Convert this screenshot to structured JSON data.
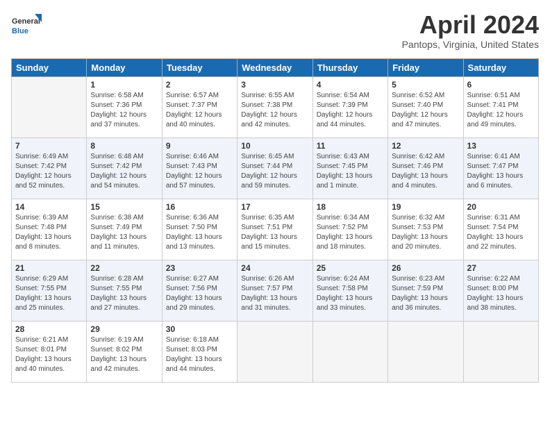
{
  "header": {
    "logo_general": "General",
    "logo_blue": "Blue",
    "main_title": "April 2024",
    "sub_title": "Pantops, Virginia, United States"
  },
  "weekdays": [
    "Sunday",
    "Monday",
    "Tuesday",
    "Wednesday",
    "Thursday",
    "Friday",
    "Saturday"
  ],
  "weeks": [
    [
      {
        "day": "",
        "sunrise": "",
        "sunset": "",
        "daylight": "",
        "empty": true
      },
      {
        "day": "1",
        "sunrise": "Sunrise: 6:58 AM",
        "sunset": "Sunset: 7:36 PM",
        "daylight": "Daylight: 12 hours and 37 minutes."
      },
      {
        "day": "2",
        "sunrise": "Sunrise: 6:57 AM",
        "sunset": "Sunset: 7:37 PM",
        "daylight": "Daylight: 12 hours and 40 minutes."
      },
      {
        "day": "3",
        "sunrise": "Sunrise: 6:55 AM",
        "sunset": "Sunset: 7:38 PM",
        "daylight": "Daylight: 12 hours and 42 minutes."
      },
      {
        "day": "4",
        "sunrise": "Sunrise: 6:54 AM",
        "sunset": "Sunset: 7:39 PM",
        "daylight": "Daylight: 12 hours and 44 minutes."
      },
      {
        "day": "5",
        "sunrise": "Sunrise: 6:52 AM",
        "sunset": "Sunset: 7:40 PM",
        "daylight": "Daylight: 12 hours and 47 minutes."
      },
      {
        "day": "6",
        "sunrise": "Sunrise: 6:51 AM",
        "sunset": "Sunset: 7:41 PM",
        "daylight": "Daylight: 12 hours and 49 minutes."
      }
    ],
    [
      {
        "day": "7",
        "sunrise": "Sunrise: 6:49 AM",
        "sunset": "Sunset: 7:42 PM",
        "daylight": "Daylight: 12 hours and 52 minutes."
      },
      {
        "day": "8",
        "sunrise": "Sunrise: 6:48 AM",
        "sunset": "Sunset: 7:42 PM",
        "daylight": "Daylight: 12 hours and 54 minutes."
      },
      {
        "day": "9",
        "sunrise": "Sunrise: 6:46 AM",
        "sunset": "Sunset: 7:43 PM",
        "daylight": "Daylight: 12 hours and 57 minutes."
      },
      {
        "day": "10",
        "sunrise": "Sunrise: 6:45 AM",
        "sunset": "Sunset: 7:44 PM",
        "daylight": "Daylight: 12 hours and 59 minutes."
      },
      {
        "day": "11",
        "sunrise": "Sunrise: 6:43 AM",
        "sunset": "Sunset: 7:45 PM",
        "daylight": "Daylight: 13 hours and 1 minute."
      },
      {
        "day": "12",
        "sunrise": "Sunrise: 6:42 AM",
        "sunset": "Sunset: 7:46 PM",
        "daylight": "Daylight: 13 hours and 4 minutes."
      },
      {
        "day": "13",
        "sunrise": "Sunrise: 6:41 AM",
        "sunset": "Sunset: 7:47 PM",
        "daylight": "Daylight: 13 hours and 6 minutes."
      }
    ],
    [
      {
        "day": "14",
        "sunrise": "Sunrise: 6:39 AM",
        "sunset": "Sunset: 7:48 PM",
        "daylight": "Daylight: 13 hours and 8 minutes."
      },
      {
        "day": "15",
        "sunrise": "Sunrise: 6:38 AM",
        "sunset": "Sunset: 7:49 PM",
        "daylight": "Daylight: 13 hours and 11 minutes."
      },
      {
        "day": "16",
        "sunrise": "Sunrise: 6:36 AM",
        "sunset": "Sunset: 7:50 PM",
        "daylight": "Daylight: 13 hours and 13 minutes."
      },
      {
        "day": "17",
        "sunrise": "Sunrise: 6:35 AM",
        "sunset": "Sunset: 7:51 PM",
        "daylight": "Daylight: 13 hours and 15 minutes."
      },
      {
        "day": "18",
        "sunrise": "Sunrise: 6:34 AM",
        "sunset": "Sunset: 7:52 PM",
        "daylight": "Daylight: 13 hours and 18 minutes."
      },
      {
        "day": "19",
        "sunrise": "Sunrise: 6:32 AM",
        "sunset": "Sunset: 7:53 PM",
        "daylight": "Daylight: 13 hours and 20 minutes."
      },
      {
        "day": "20",
        "sunrise": "Sunrise: 6:31 AM",
        "sunset": "Sunset: 7:54 PM",
        "daylight": "Daylight: 13 hours and 22 minutes."
      }
    ],
    [
      {
        "day": "21",
        "sunrise": "Sunrise: 6:29 AM",
        "sunset": "Sunset: 7:55 PM",
        "daylight": "Daylight: 13 hours and 25 minutes."
      },
      {
        "day": "22",
        "sunrise": "Sunrise: 6:28 AM",
        "sunset": "Sunset: 7:55 PM",
        "daylight": "Daylight: 13 hours and 27 minutes."
      },
      {
        "day": "23",
        "sunrise": "Sunrise: 6:27 AM",
        "sunset": "Sunset: 7:56 PM",
        "daylight": "Daylight: 13 hours and 29 minutes."
      },
      {
        "day": "24",
        "sunrise": "Sunrise: 6:26 AM",
        "sunset": "Sunset: 7:57 PM",
        "daylight": "Daylight: 13 hours and 31 minutes."
      },
      {
        "day": "25",
        "sunrise": "Sunrise: 6:24 AM",
        "sunset": "Sunset: 7:58 PM",
        "daylight": "Daylight: 13 hours and 33 minutes."
      },
      {
        "day": "26",
        "sunrise": "Sunrise: 6:23 AM",
        "sunset": "Sunset: 7:59 PM",
        "daylight": "Daylight: 13 hours and 36 minutes."
      },
      {
        "day": "27",
        "sunrise": "Sunrise: 6:22 AM",
        "sunset": "Sunset: 8:00 PM",
        "daylight": "Daylight: 13 hours and 38 minutes."
      }
    ],
    [
      {
        "day": "28",
        "sunrise": "Sunrise: 6:21 AM",
        "sunset": "Sunset: 8:01 PM",
        "daylight": "Daylight: 13 hours and 40 minutes."
      },
      {
        "day": "29",
        "sunrise": "Sunrise: 6:19 AM",
        "sunset": "Sunset: 8:02 PM",
        "daylight": "Daylight: 13 hours and 42 minutes."
      },
      {
        "day": "30",
        "sunrise": "Sunrise: 6:18 AM",
        "sunset": "Sunset: 8:03 PM",
        "daylight": "Daylight: 13 hours and 44 minutes."
      },
      {
        "day": "",
        "sunrise": "",
        "sunset": "",
        "daylight": "",
        "empty": true
      },
      {
        "day": "",
        "sunrise": "",
        "sunset": "",
        "daylight": "",
        "empty": true
      },
      {
        "day": "",
        "sunrise": "",
        "sunset": "",
        "daylight": "",
        "empty": true
      },
      {
        "day": "",
        "sunrise": "",
        "sunset": "",
        "daylight": "",
        "empty": true
      }
    ]
  ]
}
